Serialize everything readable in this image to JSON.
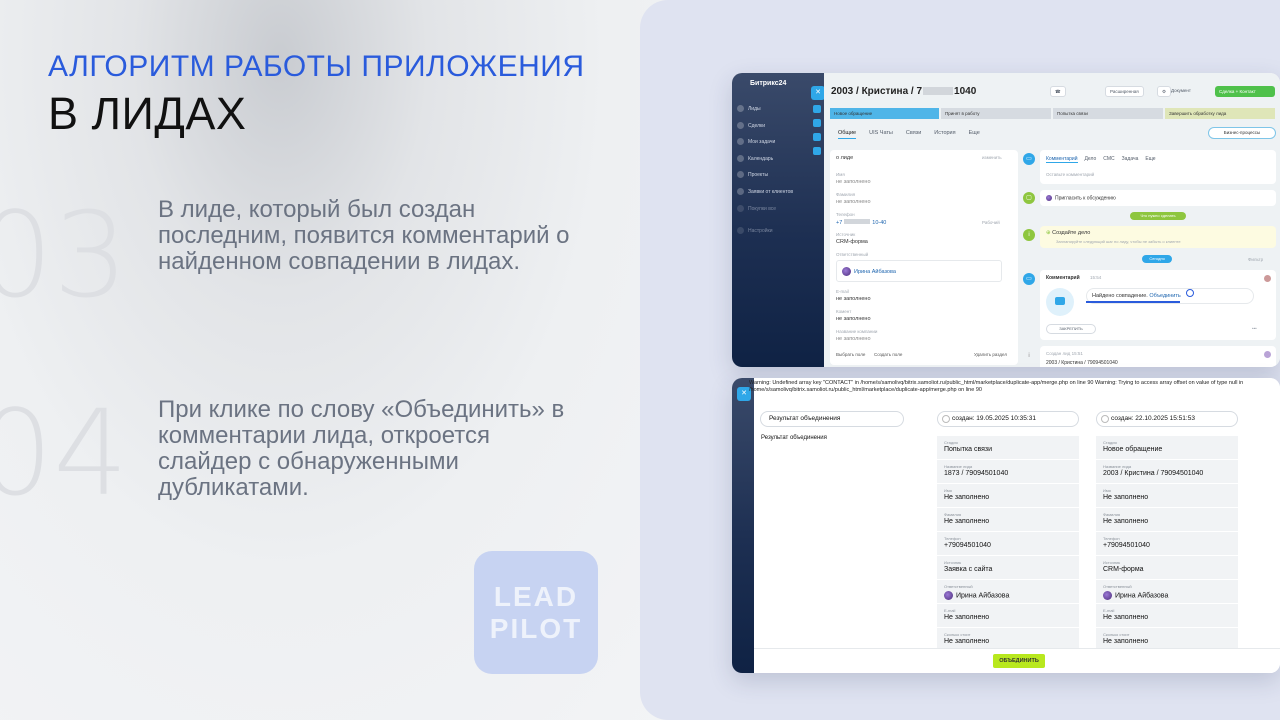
{
  "slide": {
    "title_line1": "АЛГОРИТМ РАБОТЫ ПРИЛОЖЕНИЯ",
    "title_line2": "В ЛИДАХ",
    "steps": [
      {
        "number": "03",
        "text": "В лиде, который был создан последним, появится комментарий о найденном совпадении в лидах."
      },
      {
        "number": "04",
        "text": "При клике по слову «Объединить» в комментарии лида, откроется слайдер с обнаруженными дубликатами."
      }
    ],
    "logo_line1": "LEAD",
    "logo_line2": "PILOT"
  },
  "crm_lead": {
    "app_name": "Битрикс24",
    "sidebar": [
      "Лиды",
      "Сделки",
      "Мои задачи",
      "Календарь",
      "Проекты",
      "Заявки от клиентов",
      "Покупки все",
      "Настройки"
    ],
    "lead_title": "2003 / Кристина / 7",
    "lead_title_suffix": "1040",
    "header_buttons": {
      "extended": "Расширенная",
      "document": "Документ",
      "deal_contact": "Сделка + Контакт"
    },
    "stages": [
      "Новое обращение",
      "Принят в работу",
      "Попытка связи",
      "Завершить обработку лида"
    ],
    "tabs": [
      "Общие",
      "UIS Чаты",
      "Связи",
      "История",
      "Еще"
    ],
    "business_processes": "Бизнес-процессы",
    "about": {
      "title": "о лиде",
      "edit": "изменить"
    },
    "fields": [
      {
        "label": "Имя",
        "value": "не заполнено"
      },
      {
        "label": "Фамилия",
        "value": "не заполнено"
      },
      {
        "label": "Телефон",
        "value": "+7",
        "value_suffix": "10-40",
        "type": "Рабочий"
      },
      {
        "label": "Источник",
        "value": "CRM-форма"
      },
      {
        "label": "Ответственный",
        "value": "Ирина Айбазова"
      },
      {
        "label": "E-mail",
        "value": "не заполнено"
      },
      {
        "label": "Комент",
        "value": "не заполнено"
      },
      {
        "label": "Название компании",
        "value": "не заполнено"
      }
    ],
    "select_field": "Выбрать поле",
    "create_field": "Создать поле",
    "delete_section": "Удалить раздел",
    "timeline": {
      "tabs": [
        "Комментарий",
        "Дело",
        "СМС",
        "Задача",
        "Еще"
      ],
      "comment_placeholder": "Оставьте комментарий",
      "invite": "Пригласить к обсуждению",
      "need_todo": "Что нужно сделать",
      "create_task": "Создайте дело",
      "create_task_hint": "Запланируйте следующий шаг по лиду, чтобы не забыть о клиенте",
      "today": "Сегодня",
      "filter": "Фильтр",
      "comment_label": "Комментарий",
      "comment_time": "15:54",
      "duplicate_text": "Найдено совпадение.",
      "merge_link": "Объединить",
      "pin": "ЗАКРЕПИТЬ",
      "created_label": "Создан лид",
      "created_time": "15:51",
      "created_value": "2003 / Кристина / 79094501040"
    }
  },
  "merge_slider": {
    "warning_text": "Warning: Undefined array key \"CONTACT\" in /home/s/samolivq/bitrix.samoliot.ru/public_html/marketplace/duplicate-app/merge.php on line 90 Warning: Trying to access array offset on value of type null in /home/s/samolivq/bitrix.samoliot.ru/public_html/marketplace/duplicate-app/merge.php on line 90",
    "result_title": "Результат объединения",
    "result_label": "Результат объединения",
    "columns": [
      {
        "created": "создан: 19.05.2025 10:35:31",
        "rows": [
          {
            "label": "Стадия",
            "value": "Попытка связи"
          },
          {
            "label": "Название лида",
            "value": "1873 / 79094501040"
          },
          {
            "label": "Имя",
            "value": "Не заполнено"
          },
          {
            "label": "Фамилия",
            "value": "Не заполнено"
          },
          {
            "label": "Телефон",
            "value": "+79094501040"
          },
          {
            "label": "Источник",
            "value": "Заявка с сайта"
          },
          {
            "label": "Ответственный",
            "value": "Ирина Айбазова"
          },
          {
            "label": "E-mail",
            "value": "Не заполнено"
          },
          {
            "label": "Сколько стоит",
            "value": "Не заполнено"
          }
        ]
      },
      {
        "created": "создан: 22.10.2025 15:51:53",
        "rows": [
          {
            "label": "Стадия",
            "value": "Новое обращение"
          },
          {
            "label": "Название лида",
            "value": "2003 / Кристина / 79094501040"
          },
          {
            "label": "Имя",
            "value": "Не заполнено"
          },
          {
            "label": "Фамилия",
            "value": "Не заполнено"
          },
          {
            "label": "Телефон",
            "value": "+79094501040"
          },
          {
            "label": "Источник",
            "value": "CRM-форма"
          },
          {
            "label": "Ответственный",
            "value": "Ирина Айбазова"
          },
          {
            "label": "E-mail",
            "value": "Не заполнено"
          },
          {
            "label": "Сколько стоит",
            "value": "Не заполнено"
          }
        ]
      }
    ],
    "merge_button": "ОБЪЕДИНИТЬ"
  },
  "colors": {
    "accent_blue": "#2a5bdc",
    "bitrix_blue": "#2fa7e8",
    "merge_green": "#b8e81e"
  }
}
